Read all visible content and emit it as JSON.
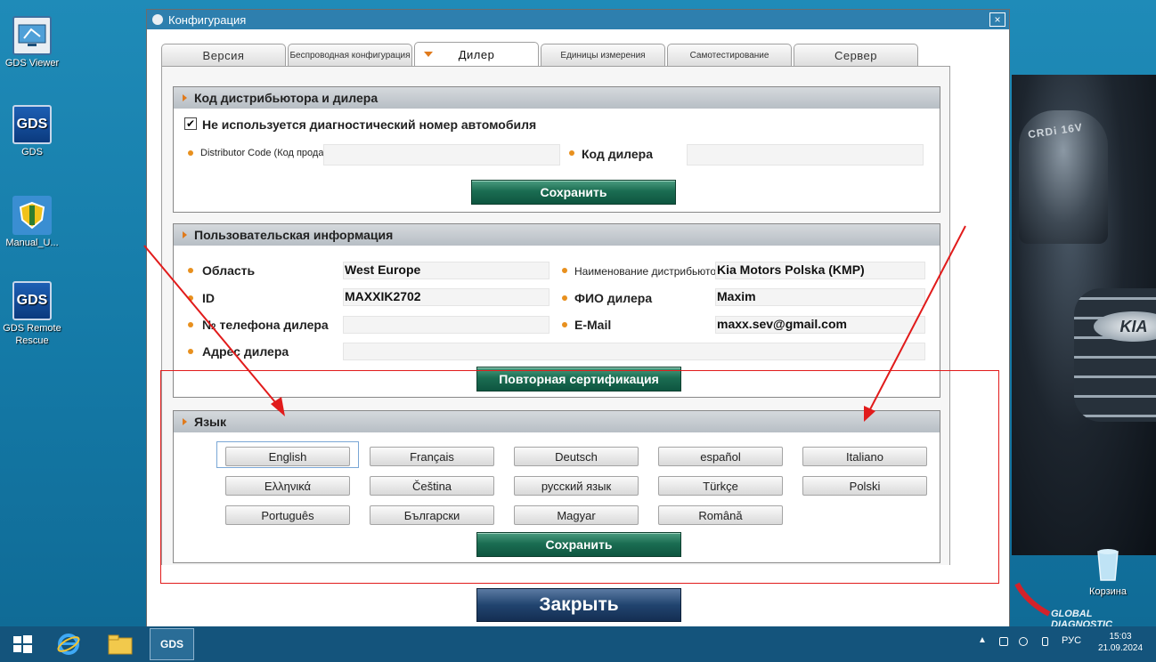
{
  "desktop": {
    "icons": [
      {
        "label": "GDS Viewer"
      },
      {
        "label": "GDS"
      },
      {
        "label": "Manual_U..."
      },
      {
        "label": "GDS Remote Rescue"
      }
    ],
    "recycle_bin": {
      "label": "Корзина"
    },
    "watermark": "GLOBAL DIAGNOSTIC SYSTEM"
  },
  "window": {
    "title": "Конфигурация",
    "close_glyph": "×",
    "tabs": [
      {
        "label": "Версия"
      },
      {
        "label": "Беспроводная конфигурация"
      },
      {
        "label": "Дилер"
      },
      {
        "label": "Единицы измерения"
      },
      {
        "label": "Самотестирование"
      },
      {
        "label": "Сервер"
      }
    ],
    "active_tab": "Дилер",
    "dealer_code_section": {
      "heading": "Код дистрибьютора и дилера",
      "checkbox_label": "Не используется диагностический номер автомобиля",
      "checkbox_checked": true,
      "distributor_code_label": "Distributor Code (Код продавца)",
      "distributor_code_value": "",
      "dealer_code_label": "Код дилера",
      "dealer_code_value": "",
      "save_label": "Сохранить"
    },
    "user_info_section": {
      "heading": "Пользовательская информация",
      "region_label": "Область",
      "region_value": "West Europe",
      "id_label": "ID",
      "id_value": "MAXXIK2702",
      "phone_label": "№ телефона дилера",
      "phone_value": "",
      "address_label": "Адрес дилера",
      "address_value": "",
      "distributor_name_label": "Наименование дистрибьютора",
      "distributor_name_value": "Kia Motors Polska (KMP)",
      "dealer_name_label": "ФИО дилера",
      "dealer_name_value": "Maxim",
      "email_label": "E-Mail",
      "email_value": "maxx.sev@gmail.com",
      "recert_label": "Повторная сертификация"
    },
    "language_section": {
      "heading": "Язык",
      "languages": [
        "English",
        "Français",
        "Deutsch",
        "español",
        "Italiano",
        "Ελληνικά",
        "Čeština",
        "русский язык",
        "Türkçe",
        "Polski",
        "Português",
        "Български",
        "Magyar",
        "Română"
      ],
      "selected": "English",
      "save_label": "Сохранить"
    },
    "close_label": "Закрыть"
  },
  "taskbar": {
    "pinned": [
      "start",
      "internet-explorer",
      "file-explorer",
      "GDS"
    ],
    "gds_label": "GDS",
    "language": "РУС",
    "time": "15:03",
    "date": "21.09.2024"
  },
  "colors": {
    "desktop": "#1a82b2",
    "titlebar": "#2e7fae",
    "accent_orange": "#e07a1c",
    "green_button": "#1b6d52",
    "close_button": "#21446f",
    "highlight_red": "#e11b1b"
  }
}
